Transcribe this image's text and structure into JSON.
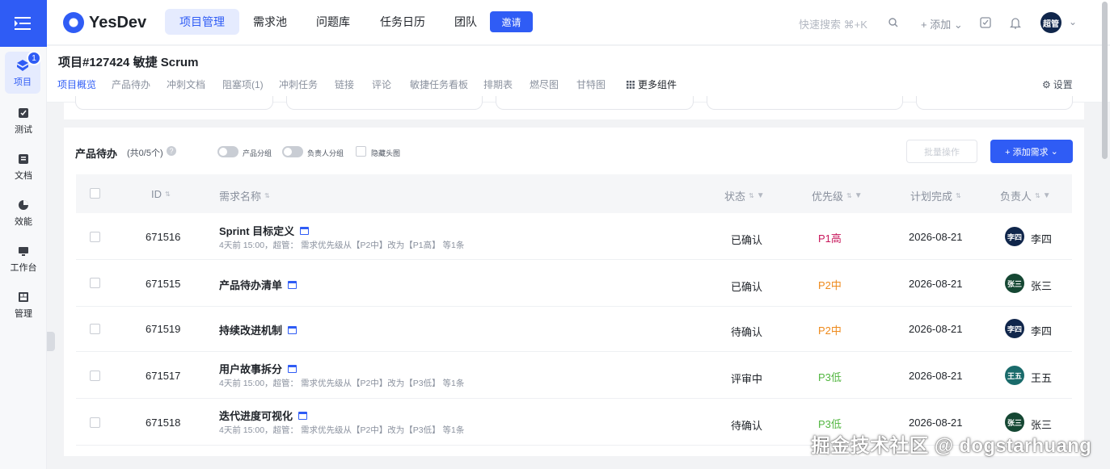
{
  "sidebar": {
    "badge": "1",
    "items": [
      {
        "label": "项目",
        "icon": "project-icon"
      },
      {
        "label": "测试",
        "icon": "test-icon"
      },
      {
        "label": "文档",
        "icon": "doc-icon"
      },
      {
        "label": "效能",
        "icon": "pie-chart-icon"
      },
      {
        "label": "工作台",
        "icon": "monitor-icon"
      },
      {
        "label": "管理",
        "icon": "grid-icon"
      }
    ]
  },
  "topnav": {
    "brand": "YesDev",
    "tabs": [
      "项目管理",
      "需求池",
      "问题库",
      "任务日历",
      "团队"
    ],
    "invite": "邀请",
    "search_hint": "快速搜索 ⌘+K",
    "add": "+ 添加",
    "user_avatar": "超管"
  },
  "project": {
    "title": "项目#127424 敏捷 Scrum",
    "tabs": [
      "项目概览",
      "产品待办",
      "冲刺文档",
      "阻塞项(1)",
      "冲刺任务",
      "链接",
      "评论",
      "敏捷任务看板",
      "排期表",
      "燃尽图",
      "甘特图",
      "更多组件"
    ],
    "settings": "设置"
  },
  "backlog": {
    "title": "产品待办",
    "count": "(共0/5个)",
    "toggle_product_group": "产品分组",
    "toggle_owner_group": "负责人分组",
    "hide_header": "隐藏头图",
    "batch": "批量操作",
    "add_req": "+ 添加需求",
    "columns": {
      "id": "ID",
      "name": "需求名称",
      "status": "状态",
      "priority": "优先级",
      "due": "计划完成",
      "owner": "负责人"
    },
    "rows": [
      {
        "id": "671516",
        "name": "Sprint 目标定义",
        "sub": "4天前 15:00，超管： 需求优先级从【P2中】改为【P1高】 等1条",
        "status": "已确认",
        "priority": "P1高",
        "due": "2026-08-21",
        "owner": "李四",
        "avatar": "李四"
      },
      {
        "id": "671515",
        "name": "产品待办清单",
        "sub": "",
        "status": "已确认",
        "priority": "P2中",
        "due": "2026-08-21",
        "owner": "张三",
        "avatar": "张三"
      },
      {
        "id": "671519",
        "name": "持续改进机制",
        "sub": "",
        "status": "待确认",
        "priority": "P2中",
        "due": "2026-08-21",
        "owner": "李四",
        "avatar": "李四"
      },
      {
        "id": "671517",
        "name": "用户故事拆分",
        "sub": "4天前 15:00，超管： 需求优先级从【P2中】改为【P3低】 等1条",
        "status": "评审中",
        "priority": "P3低",
        "due": "2026-08-21",
        "owner": "王五",
        "avatar": "王五"
      },
      {
        "id": "671518",
        "name": "迭代进度可视化",
        "sub": "4天前 15:00，超管： 需求优先级从【P2中】改为【P3低】 等1条",
        "status": "待确认",
        "priority": "P3低",
        "due": "2026-08-21",
        "owner": "张三",
        "avatar": "张三"
      }
    ]
  },
  "colors": {
    "accent": "#2f5cf5",
    "p1": "#c8175b",
    "p2": "#ee8a1c",
    "p3": "#52b640",
    "avatar_lisi": "#10264b",
    "avatar_zhangsan": "#154733",
    "avatar_wangwu": "#1a6b6b"
  },
  "watermark": "掘金技术社区 @ dogstarhuang"
}
